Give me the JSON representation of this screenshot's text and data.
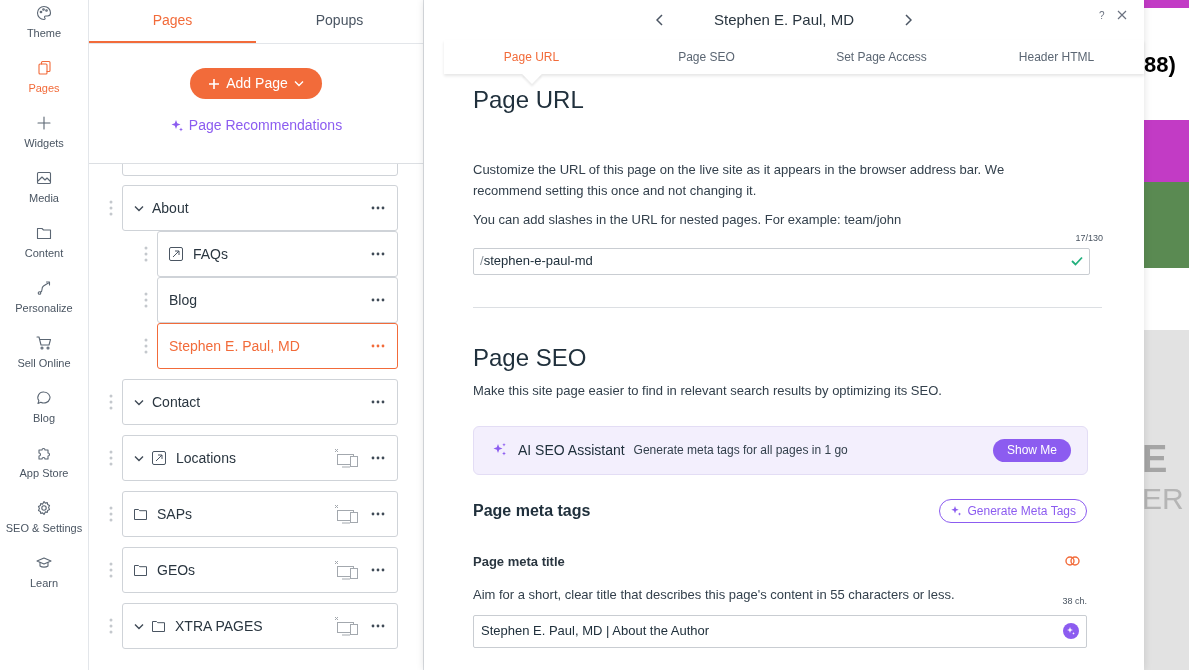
{
  "nav_rail": [
    {
      "label": "Theme",
      "selected": false
    },
    {
      "label": "Pages",
      "selected": true
    },
    {
      "label": "Widgets",
      "selected": false
    },
    {
      "label": "Media",
      "selected": false
    },
    {
      "label": "Content",
      "selected": false
    },
    {
      "label": "Personalize",
      "selected": false
    },
    {
      "label": "Sell Online",
      "selected": false
    },
    {
      "label": "Blog",
      "selected": false
    },
    {
      "label": "App Store",
      "selected": false
    },
    {
      "label": "SEO & Settings",
      "selected": false
    },
    {
      "label": "Learn",
      "selected": false
    }
  ],
  "pages_panel": {
    "tabs": [
      {
        "label": "Pages",
        "selected": true
      },
      {
        "label": "Popups",
        "selected": false
      }
    ],
    "add_button": "Add Page",
    "recommendations_link": "Page Recommendations",
    "pages": [
      {
        "title": "About",
        "kind": "page",
        "expanded": true,
        "hidden_on_devices": false,
        "selected": false,
        "children": [
          {
            "title": "FAQs",
            "kind": "link",
            "selected": false
          },
          {
            "title": "Blog",
            "kind": "page",
            "selected": false
          },
          {
            "title": "Stephen E. Paul, MD",
            "kind": "page",
            "selected": true
          }
        ]
      },
      {
        "title": "Contact",
        "kind": "page",
        "expanded": true,
        "hidden_on_devices": false,
        "selected": false
      },
      {
        "title": "Locations",
        "kind": "link",
        "expanded": true,
        "hidden_on_devices": true,
        "selected": false
      },
      {
        "title": "SAPs",
        "kind": "folder",
        "expanded": false,
        "hidden_on_devices": true,
        "selected": false
      },
      {
        "title": "GEOs",
        "kind": "folder",
        "expanded": false,
        "hidden_on_devices": true,
        "selected": false
      },
      {
        "title": "XTRA PAGES",
        "kind": "folder",
        "expanded": true,
        "hidden_on_devices": true,
        "selected": false
      }
    ]
  },
  "settings_panel": {
    "page_title": "Stephen E. Paul, MD",
    "help": "?",
    "tabs": [
      {
        "label": "Page URL",
        "selected": true
      },
      {
        "label": "Page SEO",
        "selected": false
      },
      {
        "label": "Set Page Access",
        "selected": false
      },
      {
        "label": "Header HTML",
        "selected": false
      }
    ],
    "page_url": {
      "heading": "Page URL",
      "description": "Customize the URL of this page on the live site as it appears in the browser address bar. We recommend setting this once and not changing it.",
      "hint": "You can add slashes in the URL for nested pages. For example: team/john",
      "counter": "17/130",
      "prefix": "/",
      "value": "stephen-e-paul-md",
      "valid": true
    },
    "page_seo": {
      "heading": "Page SEO",
      "description": "Make this site page easier to find in relevant search results by optimizing its SEO.",
      "ai_assistant": {
        "title": "AI SEO Assistant",
        "text": "Generate meta tags for all pages in 1 go",
        "button": "Show Me"
      },
      "meta_tags_heading": "Page meta tags",
      "generate_button": "Generate Meta Tags",
      "meta_title": {
        "label": "Page meta title",
        "hint": "Aim for a short, clear title that describes this page's content in 55 characters or less.",
        "counter": "38 ch.",
        "value": "Stephen E. Paul, MD | About the Author"
      }
    }
  },
  "preview": {
    "texts": [
      "88)",
      "E",
      "ER"
    ]
  }
}
